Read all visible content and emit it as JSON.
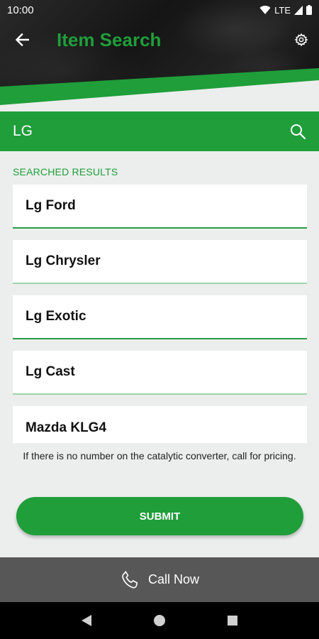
{
  "status": {
    "time": "10:00",
    "network": "LTE"
  },
  "header": {
    "title": "Item Search",
    "back_icon": "arrow-back-icon",
    "settings_icon": "gear-icon"
  },
  "search": {
    "value": "LG",
    "icon": "search-icon"
  },
  "results": {
    "label": "SEARCHED RESULTS",
    "items": [
      {
        "label": "Lg Ford"
      },
      {
        "label": "Lg Chrysler"
      },
      {
        "label": "Lg Exotic"
      },
      {
        "label": "Lg Cast"
      },
      {
        "label": "Mazda KLG4"
      }
    ]
  },
  "note": "If there is no number on the catalytic converter, call for pricing.",
  "submit_label": "SUBMIT",
  "call": {
    "label": "Call Now",
    "icon": "phone-icon"
  },
  "colors": {
    "accent": "#1f9e3a",
    "call_bar": "#575757"
  }
}
